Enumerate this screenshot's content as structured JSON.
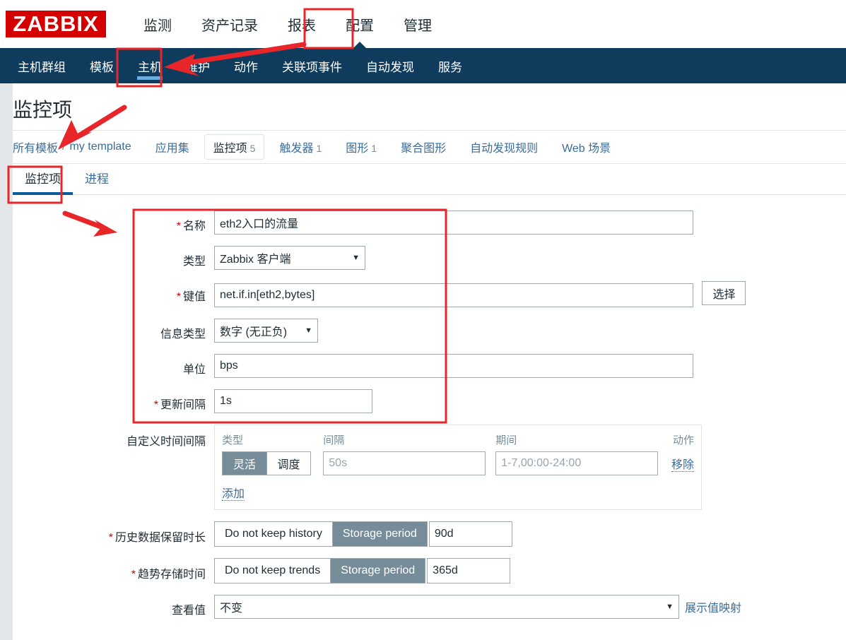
{
  "brand": {
    "logo_text": "ZABBIX",
    "logo_color": "#d40000"
  },
  "theme": {
    "navbar_bg": "#0f3c5c",
    "accent_blue": "#3a6d9b",
    "segment_on": "#768d99",
    "annotation_red": "#e8262a"
  },
  "mainnav": {
    "items": [
      {
        "label": "监测",
        "selected": false
      },
      {
        "label": "资产记录",
        "selected": false
      },
      {
        "label": "报表",
        "selected": false
      },
      {
        "label": "配置",
        "selected": true
      },
      {
        "label": "管理",
        "selected": false
      }
    ]
  },
  "subnav": {
    "items": [
      {
        "label": "主机群组",
        "selected": false
      },
      {
        "label": "模板",
        "selected": false
      },
      {
        "label": "主机",
        "selected": true
      },
      {
        "label": "维护",
        "selected": false
      },
      {
        "label": "动作",
        "selected": false
      },
      {
        "label": "关联项事件",
        "selected": false
      },
      {
        "label": "自动发现",
        "selected": false
      },
      {
        "label": "服务",
        "selected": false
      }
    ]
  },
  "page": {
    "title": "监控项"
  },
  "breadcrumb": {
    "root_label": "所有模板",
    "separator": "/",
    "template_label": "my template",
    "object_tabs": [
      {
        "label": "应用集",
        "count": "",
        "active": false
      },
      {
        "label": "监控项",
        "count": "5",
        "active": true
      },
      {
        "label": "触发器",
        "count": "1",
        "active": false
      },
      {
        "label": "图形",
        "count": "1",
        "active": false
      },
      {
        "label": "聚合图形",
        "count": "",
        "active": false
      },
      {
        "label": "自动发现规则",
        "count": "",
        "active": false
      },
      {
        "label": "Web 场景",
        "count": "",
        "active": false
      }
    ]
  },
  "subtabs": [
    {
      "label": "监控项",
      "active": true
    },
    {
      "label": "进程",
      "active": false
    }
  ],
  "form": {
    "name": {
      "label": "名称",
      "required": true,
      "value": "eth2入口的流量",
      "placeholder": ""
    },
    "type": {
      "label": "类型",
      "required": false,
      "value": "Zabbix 客户端"
    },
    "key": {
      "label": "键值",
      "required": true,
      "value": "net.if.in[eth2,bytes]",
      "placeholder": "",
      "select_button": "选择"
    },
    "value_type": {
      "label": "信息类型",
      "required": false,
      "value": "数字 (无正负)"
    },
    "units": {
      "label": "单位",
      "required": false,
      "value": "bps",
      "placeholder": ""
    },
    "update_interval": {
      "label": "更新间隔",
      "required": true,
      "value": "1s",
      "placeholder": ""
    },
    "custom_intervals": {
      "label": "自定义时间间隔",
      "columns": {
        "type": "类型",
        "interval": "间隔",
        "period": "期间",
        "action": "动作"
      },
      "rows": [
        {
          "type_flexible": "灵活",
          "type_scheduling": "调度",
          "type_selected": "灵活",
          "interval_value": "",
          "interval_placeholder": "50s",
          "period_value": "",
          "period_placeholder": "1-7,00:00-24:00",
          "remove_label": "移除"
        }
      ],
      "add_label": "添加"
    },
    "history": {
      "label": "历史数据保留时长",
      "required": true,
      "option_off": "Do not keep history",
      "option_on": "Storage period",
      "selected": "Storage period",
      "value": "90d"
    },
    "trends": {
      "label": "趋势存储时间",
      "required": true,
      "option_off": "Do not keep trends",
      "option_on": "Storage period",
      "selected": "Storage period",
      "value": "365d"
    },
    "show_value": {
      "label": "查看值",
      "required": false,
      "value": "不变",
      "link_label": "展示值映射"
    }
  },
  "icons": {
    "caret_down": "▼",
    "nav_active_caret": "▲"
  }
}
